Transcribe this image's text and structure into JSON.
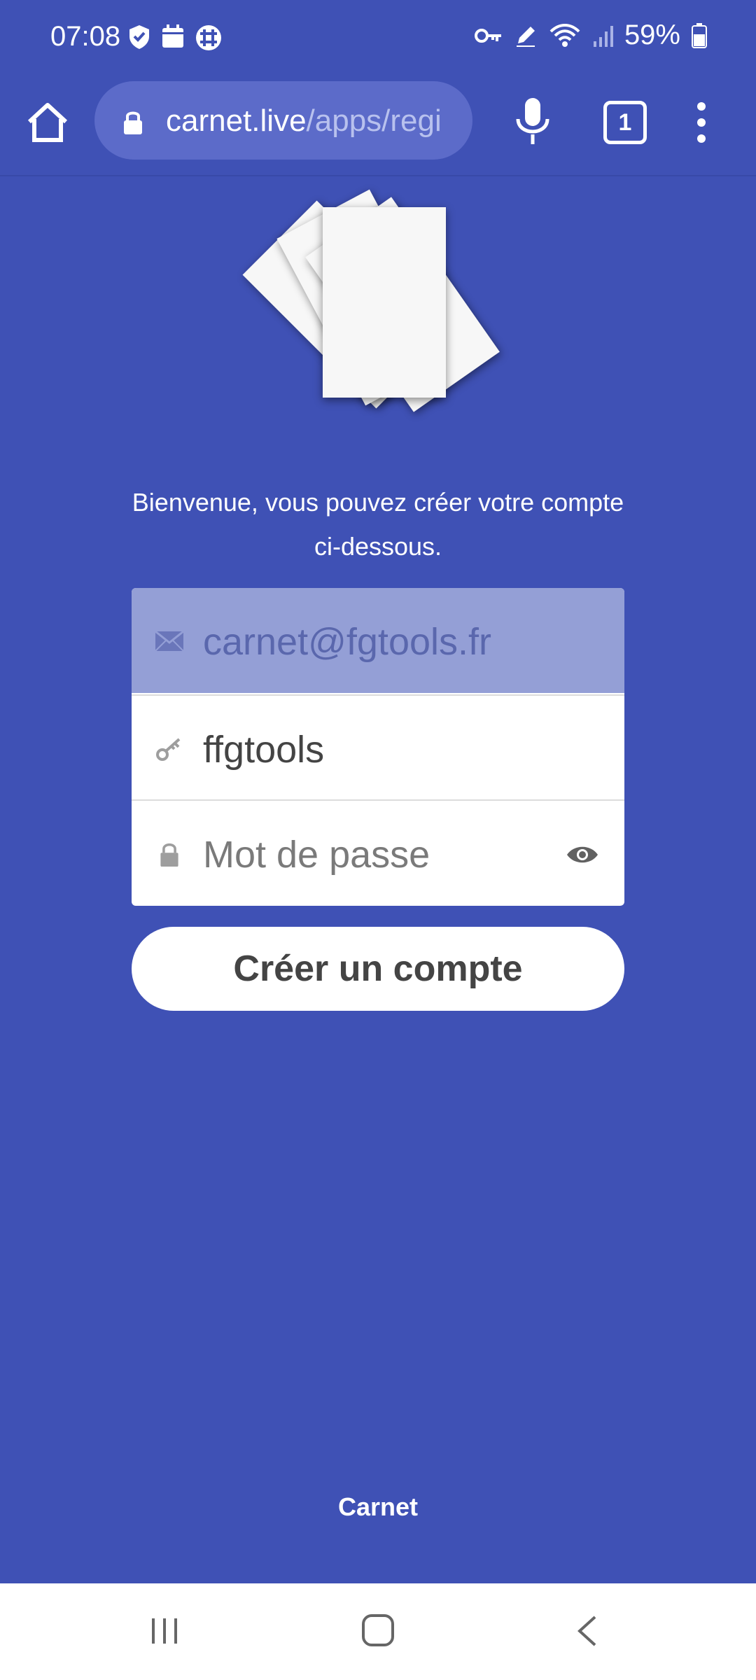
{
  "status_bar": {
    "time": "07:08",
    "battery_percent": "59%",
    "left_icons": [
      "shield-icon",
      "calendar-icon",
      "grid-app-icon"
    ],
    "right_icons": [
      "vpn-key-icon",
      "pen-icon",
      "wifi-icon",
      "signal-icon",
      "battery-icon"
    ]
  },
  "browser": {
    "url_host": "carnet.live",
    "url_path": "/apps/regi",
    "tab_count": "1"
  },
  "main": {
    "welcome_text": "Bienvenue, vous pouvez créer votre compte ci-dessous.",
    "email_value": "carnet@fgtools.fr",
    "username_value": "ffgtools",
    "password_placeholder": "Mot de passe",
    "create_button_label": "Créer un compte"
  },
  "footer": {
    "brand": "Carnet"
  },
  "colors": {
    "background": "#3f51b5",
    "email_field_bg": "#949fd6",
    "url_pill": "#5c6bc9"
  }
}
